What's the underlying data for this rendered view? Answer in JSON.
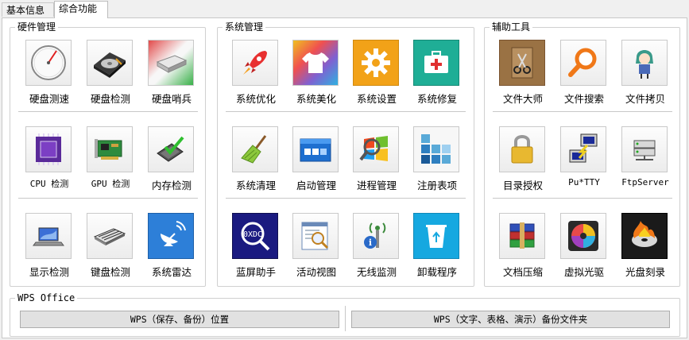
{
  "tabs": [
    "基本信息",
    "综合功能"
  ],
  "groups": {
    "hardware": {
      "title": "硬件管理",
      "items": [
        {
          "label": "硬盘测速",
          "icon": "gauge-icon"
        },
        {
          "label": "硬盘检测",
          "icon": "hard-disk-icon"
        },
        {
          "label": "硬盘哨兵",
          "icon": "disk-sentinel-icon"
        },
        {
          "label": "CPU 检测",
          "icon": "cpu-chip-icon"
        },
        {
          "label": "GPU 检测",
          "icon": "graphics-card-icon"
        },
        {
          "label": "内存检测",
          "icon": "memory-check-icon"
        },
        {
          "label": "显示检测",
          "icon": "laptop-display-icon"
        },
        {
          "label": "键盘检测",
          "icon": "keyboard-icon"
        },
        {
          "label": "系统雷达",
          "icon": "satellite-dish-icon"
        }
      ]
    },
    "system": {
      "title": "系统管理",
      "items": [
        {
          "label": "系统优化",
          "icon": "rocket-icon"
        },
        {
          "label": "系统美化",
          "icon": "t-shirt-icon"
        },
        {
          "label": "系统设置",
          "icon": "gear-icon"
        },
        {
          "label": "系统修复",
          "icon": "first-aid-kit-icon"
        },
        {
          "label": "系统清理",
          "icon": "broom-icon"
        },
        {
          "label": "启动管理",
          "icon": "startup-window-icon"
        },
        {
          "label": "进程管理",
          "icon": "process-window-icon"
        },
        {
          "label": "注册表项",
          "icon": "registry-blocks-icon"
        },
        {
          "label": "蓝屏助手",
          "icon": "bluescreen-magnifier-icon"
        },
        {
          "label": "活动视图",
          "icon": "activity-view-icon"
        },
        {
          "label": "无线监测",
          "icon": "wireless-info-icon"
        },
        {
          "label": "卸载程序",
          "icon": "recycle-bin-icon"
        }
      ]
    },
    "tools": {
      "title": "辅助工具",
      "items": [
        {
          "label": "文件大师",
          "icon": "scissors-file-icon"
        },
        {
          "label": "文件搜索",
          "icon": "search-icon"
        },
        {
          "label": "文件拷贝",
          "icon": "character-icon"
        },
        {
          "label": "目录授权",
          "icon": "padlock-icon"
        },
        {
          "label": "Pu*TTY",
          "icon": "putty-terminal-icon"
        },
        {
          "label": "FtpServer",
          "icon": "ftp-server-icon"
        },
        {
          "label": "文档压缩",
          "icon": "archive-books-icon"
        },
        {
          "label": "虚拟光驱",
          "icon": "virtual-disc-icon"
        },
        {
          "label": "光盘刻录",
          "icon": "burn-disc-icon"
        }
      ]
    }
  },
  "wps": {
    "title": "WPS Office",
    "button_location": "WPS（保存、备份）位置",
    "button_backup": "WPS（文字、表格、演示）备份文件夹"
  }
}
